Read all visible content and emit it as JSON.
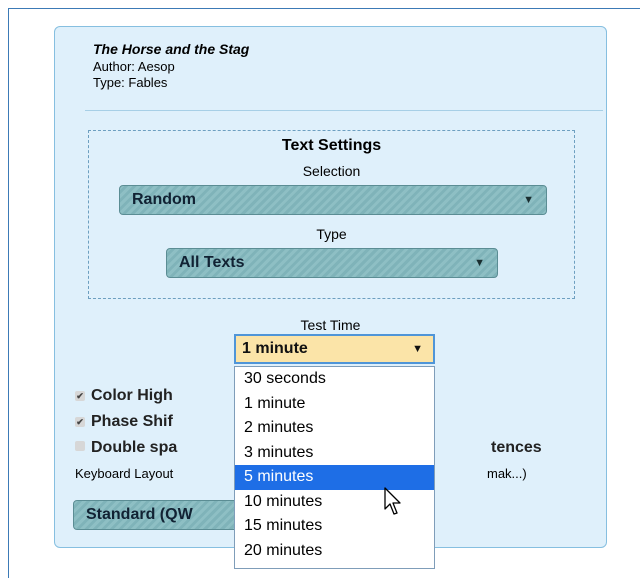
{
  "text": {
    "title": "The Horse and the Stag",
    "author": "Author: Aesop",
    "type": "Type: Fables"
  },
  "settings": {
    "heading": "Text Settings",
    "selection_label": "Selection",
    "selection_value": "Random",
    "type_label": "Type",
    "type_value": "All Texts"
  },
  "test_time": {
    "label": "Test Time",
    "value": "1 minute",
    "options": [
      "30 seconds",
      "1 minute",
      "2 minutes",
      "3 minutes",
      "5 minutes",
      "10 minutes",
      "15 minutes",
      "20 minutes"
    ],
    "highlighted": "5 minutes"
  },
  "checkboxes": {
    "color_highlight": "Color High",
    "phase_shift": "Phase Shif",
    "double_space": "Double spa",
    "double_space_tail": "tences"
  },
  "keyboard": {
    "label": "Keyboard Layout",
    "tail": "mak...)",
    "value": "Standard (QW"
  },
  "icons": {
    "dropdown_arrow": "▼",
    "check": "✔"
  }
}
